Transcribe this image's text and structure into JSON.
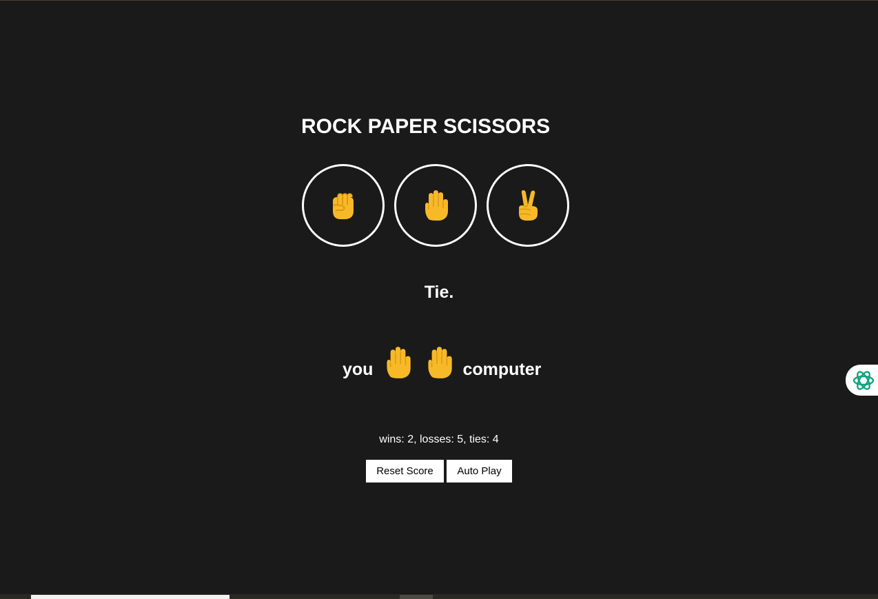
{
  "title": "ROCK PAPER SCISSORS",
  "moves": [
    {
      "name": "rock",
      "icon": "fist-icon"
    },
    {
      "name": "paper",
      "icon": "raised-hand-icon"
    },
    {
      "name": "scissors",
      "icon": "victory-hand-icon"
    }
  ],
  "result": "Tie.",
  "moves_display": {
    "you_label": "you",
    "you_move_icon": "raised-hand-icon",
    "computer_move_icon": "raised-hand-icon",
    "computer_label": "computer"
  },
  "score": "wins: 2, losses: 5, ties: 4",
  "buttons": {
    "reset": "Reset Score",
    "autoplay": "Auto Play"
  },
  "side_widget": {
    "icon": "ai-assistant-icon",
    "color": "#10a37f"
  },
  "colors": {
    "background": "#1a1a1a",
    "text": "#ffffff",
    "emoji": "#f7b928"
  }
}
